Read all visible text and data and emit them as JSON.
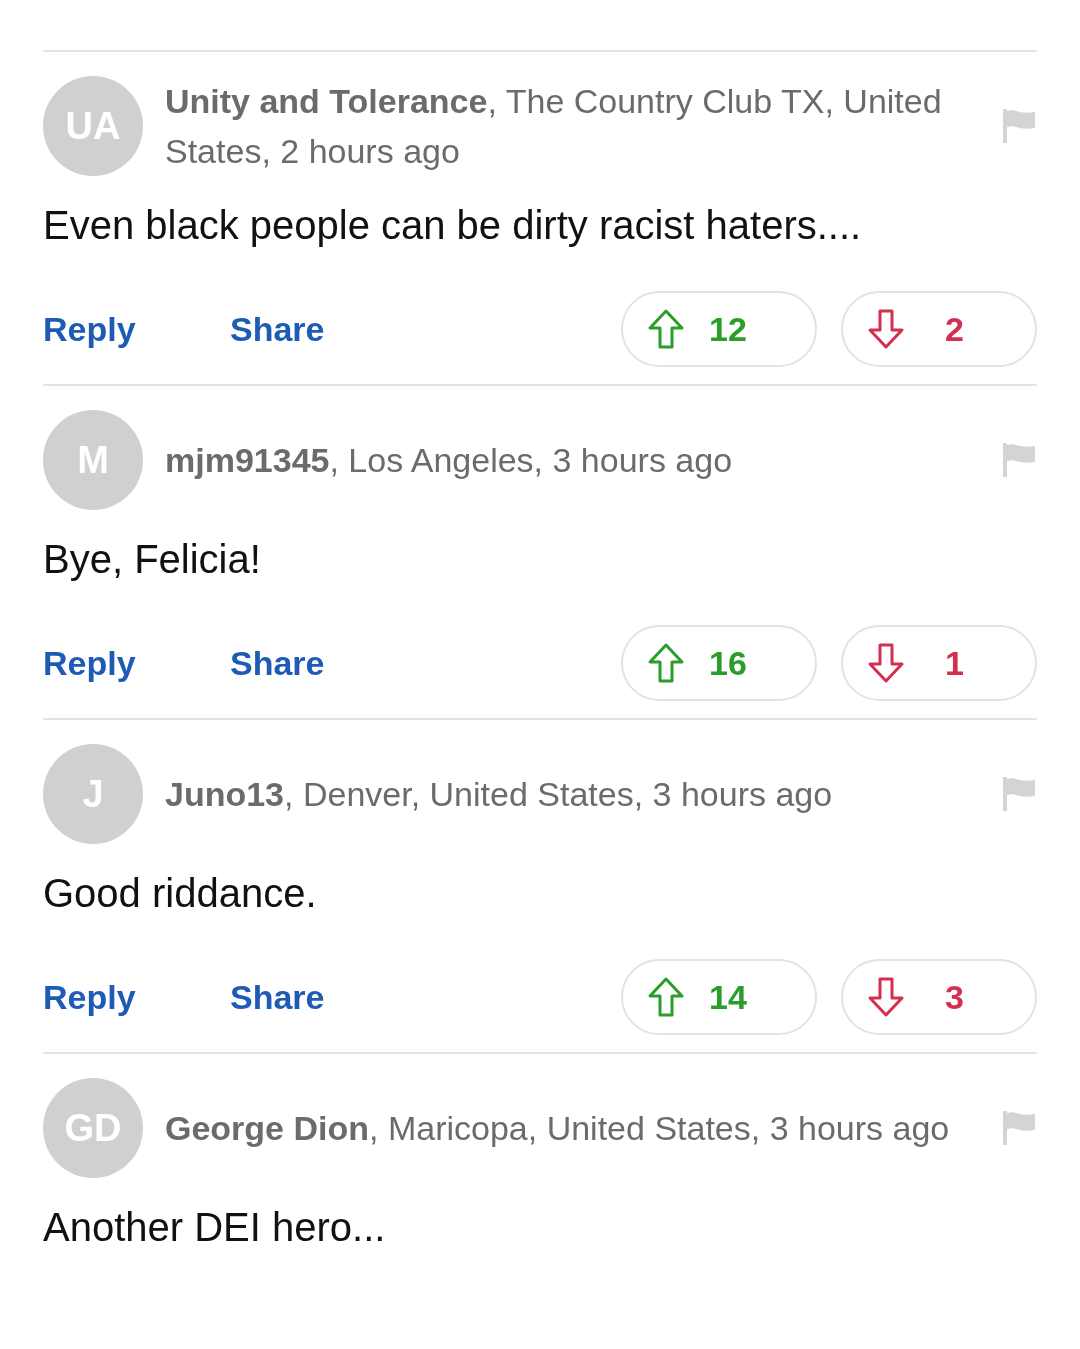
{
  "comments": [
    {
      "initials": "UA",
      "byline": "**Unity and Tolerance**, The Country Club TX, United States, 2 hours ago",
      "body": "Even black people can be dirty racist haters....",
      "reply": "Reply",
      "share": "Share",
      "upvotes": "12",
      "downvotes": "2"
    },
    {
      "initials": "M",
      "byline": "**mjm91345**, Los Angeles, 3 hours ago",
      "body": "Bye, Felicia!",
      "reply": "Reply",
      "share": "Share",
      "upvotes": "16",
      "downvotes": "1"
    },
    {
      "initials": "J",
      "byline": "**Juno13**, Denver, United States, 3 hours ago",
      "body": "Good riddance.",
      "reply": "Reply",
      "share": "Share",
      "upvotes": "14",
      "downvotes": "3"
    },
    {
      "initials": "GD",
      "byline": "**George Dion**, Maricopa, United States, 3 hours ago",
      "body": "Another DEI hero..."
    }
  ]
}
